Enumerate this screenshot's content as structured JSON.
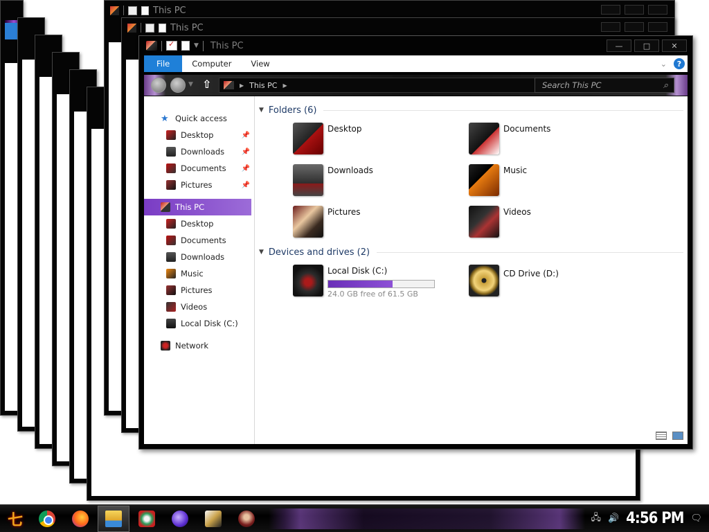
{
  "window": {
    "title": "This PC",
    "controls": {
      "minimize": "—",
      "maximize": "□",
      "close": "✕"
    }
  },
  "background_windows": {
    "title": "This PC"
  },
  "ribbon": {
    "tabs": [
      {
        "label": "File"
      },
      {
        "label": "Computer"
      },
      {
        "label": "View"
      }
    ],
    "help": "?"
  },
  "address_bar": {
    "path": "This PC",
    "search_placeholder": "Search This PC"
  },
  "nav_pane": {
    "quick_access": "Quick access",
    "quick_items": [
      {
        "label": "Desktop"
      },
      {
        "label": "Downloads"
      },
      {
        "label": "Documents"
      },
      {
        "label": "Pictures"
      }
    ],
    "this_pc": "This PC",
    "pc_items": [
      {
        "label": "Desktop"
      },
      {
        "label": "Documents"
      },
      {
        "label": "Downloads"
      },
      {
        "label": "Music"
      },
      {
        "label": "Pictures"
      },
      {
        "label": "Videos"
      },
      {
        "label": "Local Disk (C:)"
      }
    ],
    "network": "Network"
  },
  "content": {
    "folders_header": "Folders (6)",
    "folders": [
      {
        "label": "Desktop"
      },
      {
        "label": "Documents"
      },
      {
        "label": "Downloads"
      },
      {
        "label": "Music"
      },
      {
        "label": "Pictures"
      },
      {
        "label": "Videos"
      }
    ],
    "devices_header": "Devices and drives (2)",
    "drives": [
      {
        "label": "Local Disk (C:)",
        "free_text": "24.0 GB free of 61.5 GB",
        "used_fraction": 0.61
      },
      {
        "label": "CD Drive (D:)"
      }
    ]
  },
  "taskbar": {
    "clock": "4:56 PM",
    "start_glyph": "七"
  },
  "colors": {
    "accent_purple": "#7a3cc4",
    "file_tab_blue": "#1f80d8",
    "window_frame": "#030303"
  }
}
